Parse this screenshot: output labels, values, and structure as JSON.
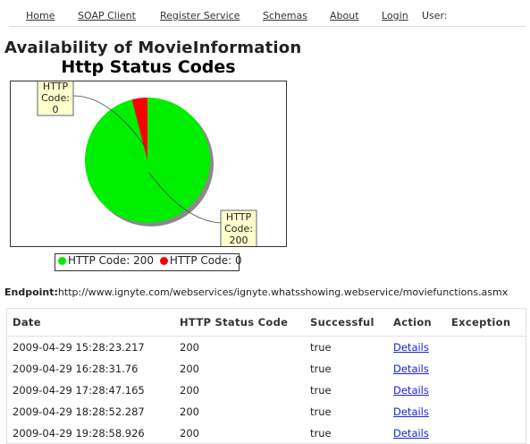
{
  "nav": {
    "items": [
      "Home",
      "SOAP Client",
      "Register Service",
      "Schemas",
      "About",
      "Login"
    ],
    "user_label": "User:"
  },
  "page_title": "Availability of MovieInformation",
  "chart_data": {
    "type": "pie",
    "title": "Http Status Codes",
    "slices": [
      {
        "label": "HTTP Code: 200",
        "value": 96,
        "color": "#00ee00"
      },
      {
        "label": "HTTP Code: 0",
        "value": 4,
        "color": "#ff0000"
      }
    ],
    "callouts": [
      {
        "lines": [
          "HTTP",
          "Code:",
          "0"
        ]
      },
      {
        "lines": [
          "HTTP",
          "Code:",
          "200"
        ]
      }
    ],
    "legend": {
      "placement": "bottom",
      "entries": [
        "HTTP Code: 200",
        "HTTP Code: 0"
      ]
    }
  },
  "endpoint": {
    "label": "Endpoint:",
    "url": "http://www.ignyte.com/webservices/ignyte.whatsshowing.webservice/moviefunctions.asmx"
  },
  "table": {
    "headers": [
      "Date",
      "HTTP Status Code",
      "Successful",
      "Action",
      "Exception"
    ],
    "rows": [
      {
        "date": "2009-04-29 15:28:23.217",
        "status": "200",
        "successful": "true",
        "action": "Details",
        "exception": ""
      },
      {
        "date": "2009-04-29 16:28:31.76",
        "status": "200",
        "successful": "true",
        "action": "Details",
        "exception": ""
      },
      {
        "date": "2009-04-29 17:28:47.165",
        "status": "200",
        "successful": "true",
        "action": "Details",
        "exception": ""
      },
      {
        "date": "2009-04-29 18:28:52.287",
        "status": "200",
        "successful": "true",
        "action": "Details",
        "exception": ""
      },
      {
        "date": "2009-04-29 19:28:58.926",
        "status": "200",
        "successful": "true",
        "action": "Details",
        "exception": ""
      }
    ]
  }
}
